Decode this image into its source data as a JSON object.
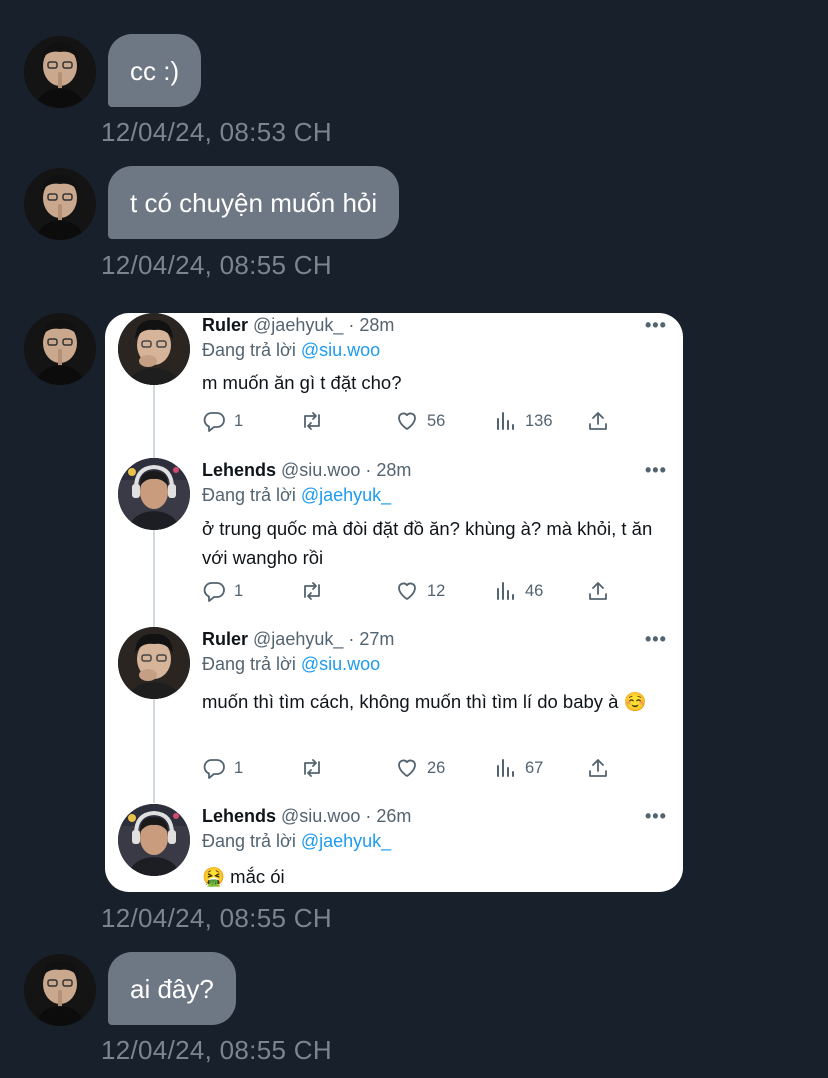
{
  "messages": [
    {
      "text": "cc :)",
      "timestamp": "12/04/24, 08:53 CH"
    },
    {
      "text": "t có chuyện muốn hỏi",
      "timestamp": "12/04/24, 08:55 CH"
    },
    {
      "timestamp": "12/04/24, 08:55 CH"
    },
    {
      "text": "ai đây?",
      "timestamp": "12/04/24, 08:55 CH"
    }
  ],
  "thread": [
    {
      "name": "Ruler",
      "handle": "@jaehyuk_",
      "time": "· 28m",
      "reply_prefix": "Đang trả lời ",
      "reply_to": "@siu.woo",
      "text": "m muốn ăn gì t đặt cho?",
      "replies": "1",
      "likes": "56",
      "views": "136"
    },
    {
      "name": "Lehends",
      "handle": "@siu.woo",
      "time": "· 28m",
      "reply_prefix": "Đang trả lời ",
      "reply_to": "@jaehyuk_",
      "text": "ở trung quốc mà đòi đặt đồ ăn? khùng à? mà khỏi, t ăn với wangho rồi",
      "replies": "1",
      "likes": "12",
      "views": "46"
    },
    {
      "name": "Ruler",
      "handle": "@jaehyuk_",
      "time": "· 27m",
      "reply_prefix": "Đang trả lời ",
      "reply_to": "@siu.woo",
      "text": "muốn thì tìm cách, không muốn thì tìm lí do baby à ☺️",
      "replies": "1",
      "likes": "26",
      "views": "67"
    },
    {
      "name": "Lehends",
      "handle": "@siu.woo",
      "time": "· 26m",
      "reply_prefix": "Đang trả lời ",
      "reply_to": "@jaehyuk_",
      "text": "🤮  mắc ói"
    }
  ],
  "icons": {
    "more": "•••",
    "reply": "reply-icon",
    "retweet": "retweet-icon",
    "like": "heart-icon",
    "views": "views-icon",
    "share": "share-icon"
  },
  "colors": {
    "background": "#18202b",
    "bubble": "#6e7784",
    "timestamp": "#7b8591",
    "mention": "#1d9bf0"
  }
}
